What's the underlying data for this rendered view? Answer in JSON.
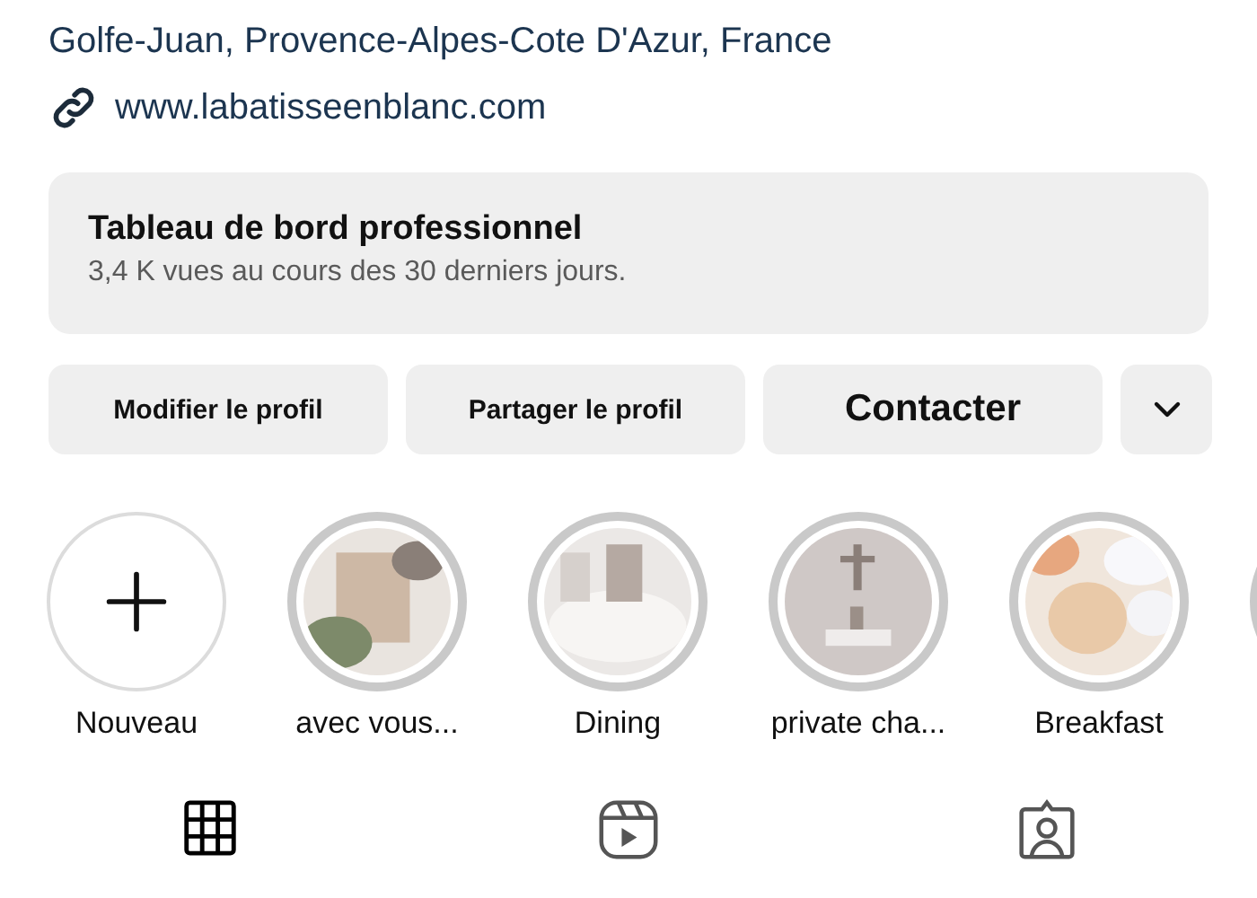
{
  "profile": {
    "location": "Golfe-Juan, Provence-Alpes-Cote D'Azur, France",
    "website": "www.labatisseenblanc.com"
  },
  "dashboard": {
    "title": "Tableau de bord professionnel",
    "subtitle": "3,4 K vues au cours des 30 derniers jours."
  },
  "actions": [
    {
      "kind": "text",
      "label": "Modifier le profil"
    },
    {
      "kind": "text",
      "label": "Partager le profil"
    },
    {
      "kind": "large",
      "label": "Contacter"
    },
    {
      "kind": "more"
    }
  ],
  "highlights": [
    {
      "kind": "new",
      "title": "Nouveau"
    },
    {
      "kind": "highlight",
      "title": "avec vous..."
    },
    {
      "kind": "highlight",
      "title": "Dining"
    },
    {
      "kind": "highlight",
      "title": "private cha..."
    },
    {
      "kind": "highlight",
      "title": "Breakfast"
    },
    {
      "kind": "highlight"
    }
  ],
  "tabs": [
    {
      "kind": "grid",
      "selected": true
    },
    {
      "kind": "reels",
      "selected": false
    },
    {
      "kind": "tagged",
      "selected": false
    }
  ]
}
